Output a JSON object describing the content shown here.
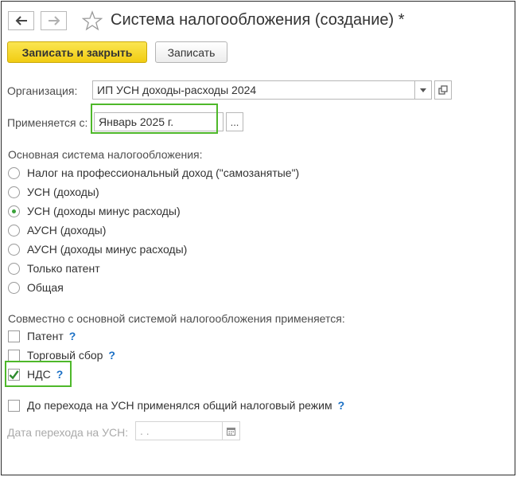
{
  "header": {
    "back_icon": "arrow-left-icon",
    "forward_icon": "arrow-right-icon",
    "favorite_icon": "star-icon",
    "title": "Система налогообложения (создание) *"
  },
  "toolbar": {
    "save_close_label": "Записать и закрыть",
    "save_label": "Записать"
  },
  "fields": {
    "organization": {
      "label": "Организация:",
      "value": "ИП УСН доходы-расходы 2024"
    },
    "applies_from": {
      "label": "Применяется с:",
      "value": "Январь 2025 г.",
      "picker": "..."
    }
  },
  "main_system": {
    "label": "Основная система налогообложения:",
    "selected_index": 2,
    "options": [
      "Налог на профессиональный доход (\"самозанятые\")",
      "УСН (доходы)",
      "УСН (доходы минус расходы)",
      "АУСН (доходы)",
      "АУСН (доходы минус расходы)",
      "Только патент",
      "Общая"
    ]
  },
  "combined": {
    "label": "Совместно с основной системой налогообложения применяется:",
    "items": [
      {
        "label": "Патент",
        "checked": false,
        "help": "?"
      },
      {
        "label": "Торговый сбор",
        "checked": false,
        "help": "?"
      },
      {
        "label": "НДС",
        "checked": true,
        "help": "?"
      }
    ]
  },
  "transition": {
    "label": "До перехода на УСН применялся общий налоговый режим",
    "checked": false,
    "help": "?",
    "date_label": "Дата перехода на УСН:",
    "date_value": " .  ."
  },
  "colors": {
    "primary_button": "#f4d523",
    "highlight": "#4eb82a",
    "help": "#1a6fc4",
    "check": "#2e8b2e"
  }
}
